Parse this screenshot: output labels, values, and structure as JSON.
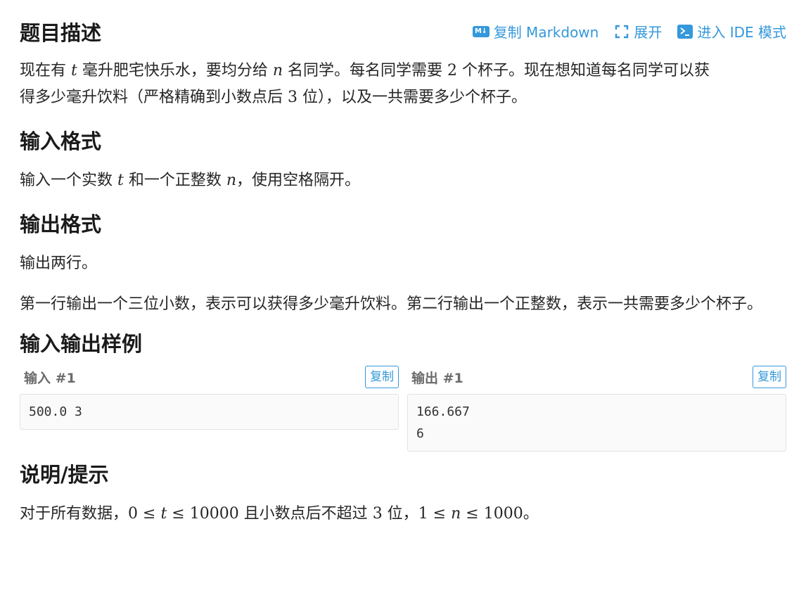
{
  "toolbar": {
    "copy_markdown": "复制 Markdown",
    "expand": "展开",
    "ide_mode": "进入 IDE 模式"
  },
  "sections": {
    "description": {
      "title": "题目描述",
      "line1_a": "现在有 ",
      "line1_t": "t",
      "line1_b": " 毫升肥宅快乐水，要均分给 ",
      "line1_n": "n",
      "line1_c": " 名同学。每名同学需要 ",
      "line1_2": "2",
      "line1_d": " 个杯子。现在想知道每名同学可以获",
      "line2_a": "得多少毫升饮料（严格精确到小数点后 ",
      "line2_3": "3",
      "line2_b": " 位），以及一共需要多少个杯子。"
    },
    "input_format": {
      "title": "输入格式",
      "text_a": "输入一个实数 ",
      "text_t": "t",
      "text_b": " 和一个正整数 ",
      "text_n": "n",
      "text_c": "，使用空格隔开。"
    },
    "output_format": {
      "title": "输出格式",
      "p1": "输出两行。",
      "p2": "第一行输出一个三位小数，表示可以获得多少毫升饮料。第二行输出一个正整数，表示一共需要多少个杯子。"
    },
    "samples": {
      "title": "输入输出样例",
      "input_title": "输入 #1",
      "output_title": "输出 #1",
      "copy_label": "复制",
      "input_value": "500.0 3",
      "output_value": "166.667\n6"
    },
    "hint": {
      "title": "说明/提示",
      "text_a": "对于所有数据，",
      "math1": "0 ≤ ",
      "math1_t": "t",
      "math1_b": " ≤ 10000",
      "text_b": " 且小数点后不超过 ",
      "math2": "3",
      "text_c": " 位，",
      "math3": "1 ≤ ",
      "math3_n": "n",
      "math3_b": " ≤ 1000",
      "text_d": "。"
    }
  },
  "colors": {
    "accent": "#3498db",
    "text": "#262626"
  }
}
